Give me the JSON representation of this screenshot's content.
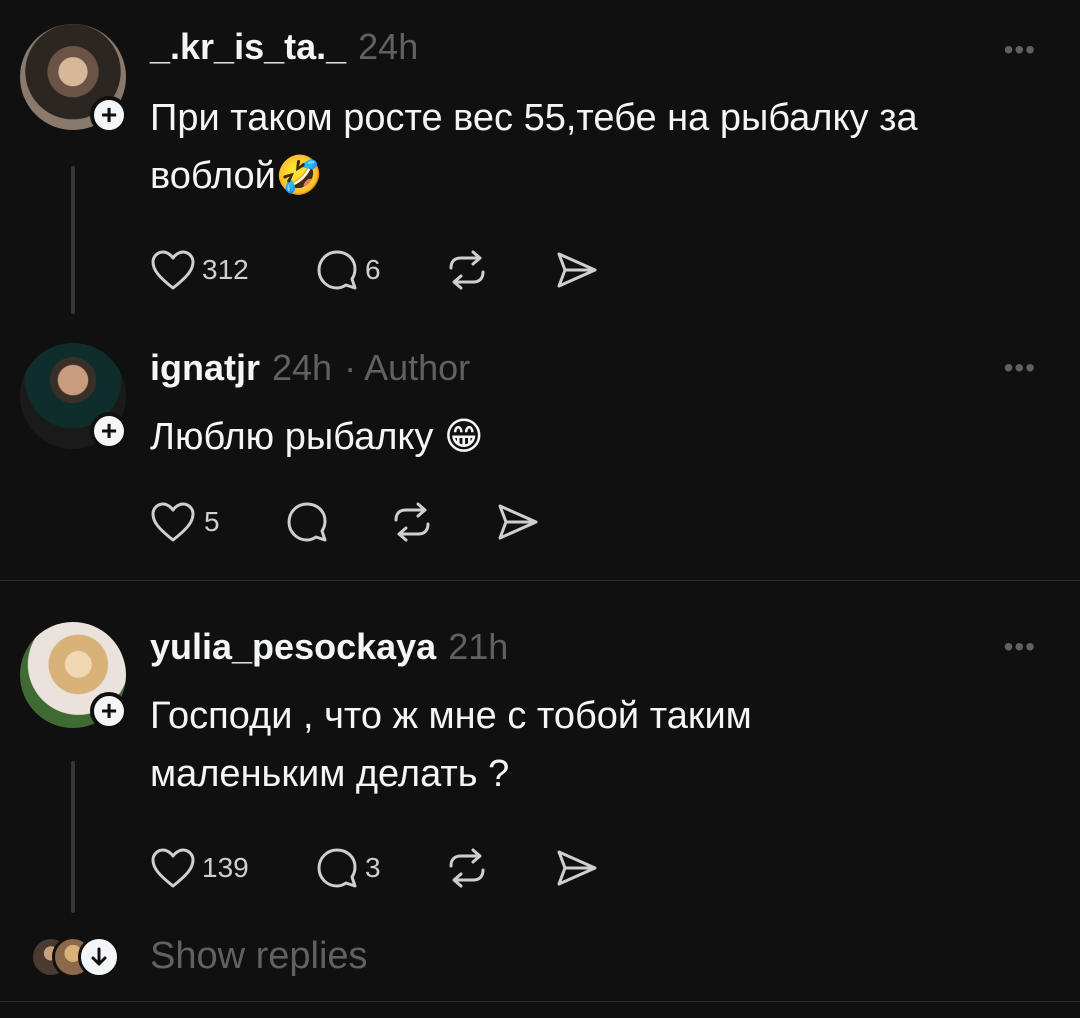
{
  "posts": [
    {
      "username": "_.kr_is_ta._",
      "time": "24h",
      "author_label": "",
      "text": "При таком росте вес 55,тебе на рыбалку за воблой🤣",
      "likes": "312",
      "replies": "6"
    },
    {
      "username": "ignatjr",
      "time": "24h",
      "author_label": "· Author",
      "text": "Люблю рыбалку 😁",
      "likes": "5",
      "replies": ""
    },
    {
      "username": "yulia_pesockaya",
      "time": "21h",
      "author_label": "",
      "text": "Господи , что ж мне с тобой таким маленьким делать ?",
      "likes": "139",
      "replies": "3"
    }
  ],
  "more_label": "•••",
  "follow_label": "+",
  "show_replies": "Show replies",
  "icons": {
    "like": "heart-icon",
    "reply": "comment-icon",
    "repost": "repost-icon",
    "share": "send-icon",
    "expand": "arrow-down-icon"
  }
}
